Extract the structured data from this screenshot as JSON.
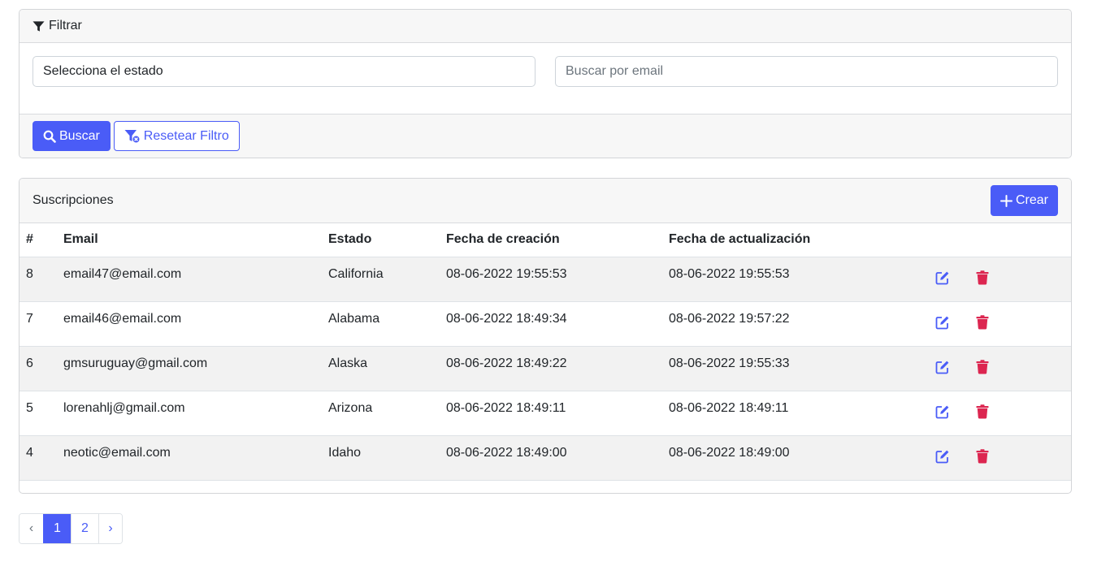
{
  "filter": {
    "title": "Filtrar",
    "state_select_value": "Selecciona el estado",
    "email_placeholder": "Buscar por email",
    "search_button": "Buscar",
    "reset_button": "Resetear Filtro"
  },
  "table": {
    "title": "Suscripciones",
    "create_button": "Crear",
    "columns": [
      "#",
      "Email",
      "Estado",
      "Fecha de creación",
      "Fecha de actualización",
      ""
    ],
    "rows": [
      {
        "id": "8",
        "email": "email47@email.com",
        "state": "California",
        "created": "08-06-2022 19:55:53",
        "updated": "08-06-2022 19:55:53"
      },
      {
        "id": "7",
        "email": "email46@email.com",
        "state": "Alabama",
        "created": "08-06-2022 18:49:34",
        "updated": "08-06-2022 19:57:22"
      },
      {
        "id": "6",
        "email": "gmsuruguay@gmail.com",
        "state": "Alaska",
        "created": "08-06-2022 18:49:22",
        "updated": "08-06-2022 19:55:33"
      },
      {
        "id": "5",
        "email": "lorenahlj@gmail.com",
        "state": "Arizona",
        "created": "08-06-2022 18:49:11",
        "updated": "08-06-2022 18:49:11"
      },
      {
        "id": "4",
        "email": "neotic@email.com",
        "state": "Idaho",
        "created": "08-06-2022 18:49:00",
        "updated": "08-06-2022 18:49:00"
      }
    ]
  },
  "pagination": {
    "prev": "‹",
    "pages": [
      "1",
      "2"
    ],
    "active": "1",
    "next": "›"
  },
  "icons": {
    "filter": "filter-icon",
    "search": "search-icon",
    "reset_filter": "filter-clear-icon",
    "create": "plus-icon",
    "edit": "edit-icon",
    "delete": "trash-icon"
  },
  "colors": {
    "primary": "#4a5cf7",
    "danger": "#dc2650",
    "header_bg": "#f7f7f7",
    "stripe": "#f2f2f2"
  }
}
